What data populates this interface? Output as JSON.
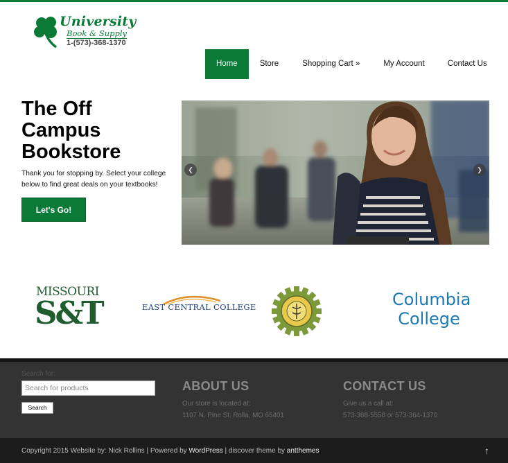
{
  "logo": {
    "line1": "University",
    "line2": "Book & Supply",
    "phone": "1-(573)-368-1370"
  },
  "nav": {
    "items": [
      "Home",
      "Store",
      "Shopping Cart »",
      "My Account",
      "Contact Us"
    ],
    "active": "Home"
  },
  "hero": {
    "title_line1": "The Off",
    "title_line2": "Campus",
    "title_line3": "Bookstore",
    "text": "Thank you for stopping by. Select your college below to find great deals on your textbooks!",
    "cta_label": "Let's Go!"
  },
  "slider": {
    "prev_icon": "chevron-left-icon",
    "next_icon": "chevron-right-icon"
  },
  "colleges": {
    "mst_line1": "MISSOURI",
    "mst_line2": "S&T",
    "ecc": "EAST CENTRAL COLLEGE",
    "columbia_line1": "Columbia",
    "columbia_line2": "College"
  },
  "footer": {
    "search_label": "Search for:",
    "search_placeholder": "Search for products",
    "search_button": "Search",
    "about_heading": "ABOUT US",
    "about_line1": "Our store is located at:",
    "about_line2": "1107 N. Pine St. Rolla, MO 65401",
    "contact_heading": "CONTACT US",
    "contact_line1": "Give us a call at:",
    "contact_line2": "573-368-5558 or 573-364-1370"
  },
  "bottom": {
    "copyright_prefix": "Copyright 2015 Website by: Nick Rollins | Powered by ",
    "wordpress": "WordPress",
    "middle": " | discover theme by ",
    "theme_author": "antthemes",
    "to_top": "↑"
  },
  "colors": {
    "brand_green": "#0a7a36",
    "footer_bg": "#333333",
    "bottom_bg": "#1c1c1c",
    "columbia_blue": "#1d79b4"
  }
}
